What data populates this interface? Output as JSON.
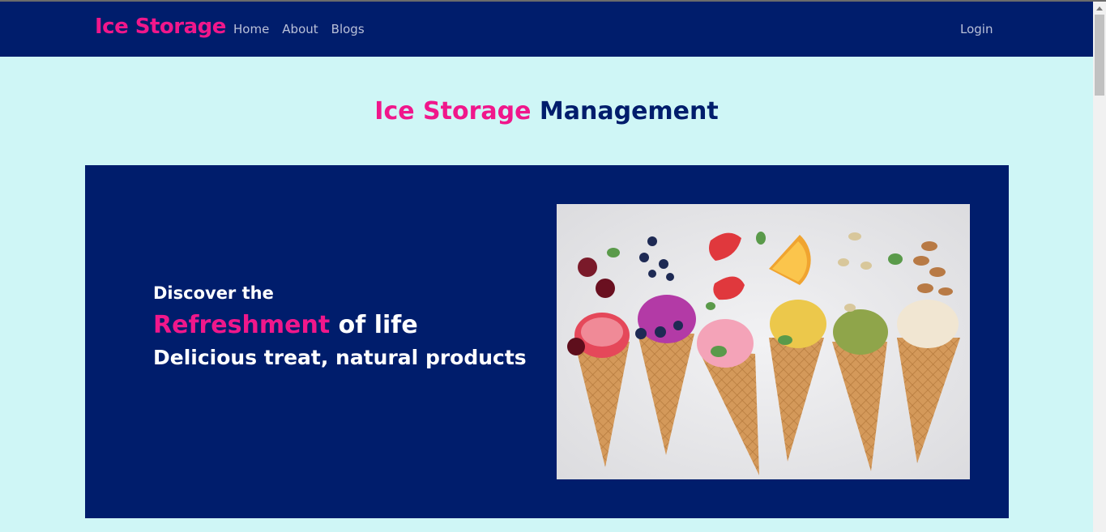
{
  "navbar": {
    "brand": "Ice Storage",
    "links": [
      "Home",
      "About",
      "Blogs"
    ],
    "login": "Login"
  },
  "page_title": {
    "highlight": "Ice Storage",
    "rest": "Management"
  },
  "hero": {
    "line1": "Discover the",
    "highlight": "Refreshment",
    "line2_rest": " of life",
    "line3": "Delicious treat, natural products",
    "image_alt": "ice-cream-cones-image"
  },
  "colors": {
    "brand_pink": "#f0178b",
    "navy": "#001d6c",
    "page_bg": "#cff6f6"
  }
}
